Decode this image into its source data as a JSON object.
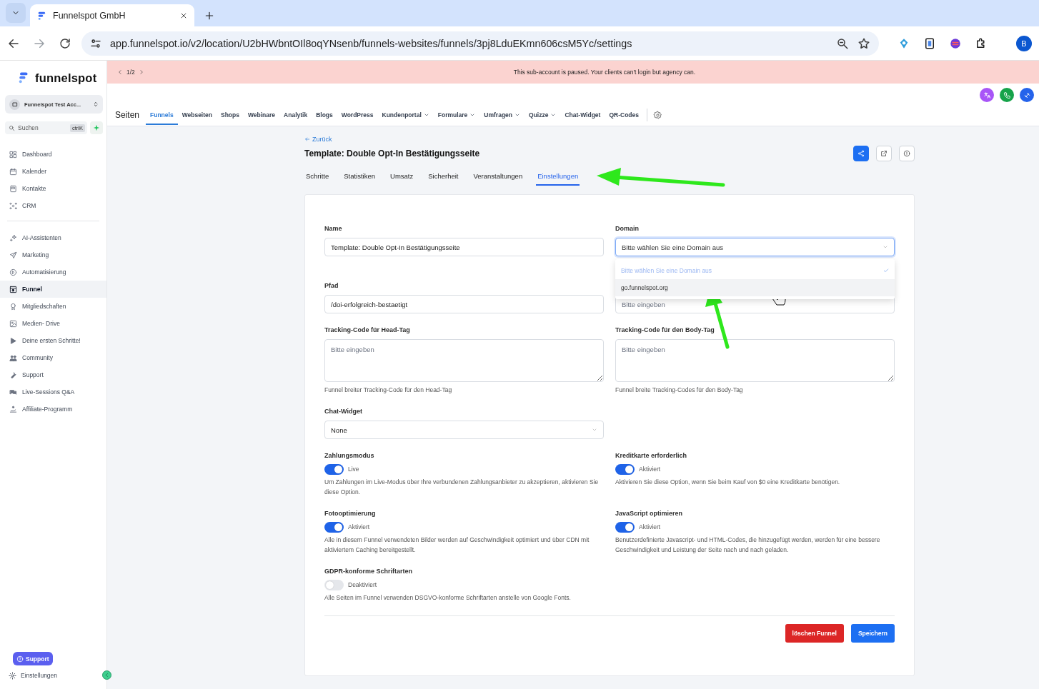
{
  "browser": {
    "tab_title": "Funnelspot GmbH",
    "url": "app.funnelspot.io/v2/location/U2bHWbntOIl8oqYNsenb/funnels-websites/funnels/3pj8LduEKmn606csM5Yc/settings",
    "profile_initial": "B"
  },
  "sidebar": {
    "logo": "funnelspot",
    "account": "Funnelspot Test Acc...",
    "search": {
      "placeholder": "Suchen",
      "shortcut": "ctrlK"
    },
    "groups": [
      {
        "items": [
          {
            "label": "Dashboard",
            "selected": false
          },
          {
            "label": "Kalender",
            "selected": false
          },
          {
            "label": "Kontakte",
            "selected": false
          },
          {
            "label": "CRM",
            "selected": false
          }
        ]
      },
      {
        "items": [
          {
            "label": "AI-Assistenten",
            "selected": false
          },
          {
            "label": "Marketing",
            "selected": false
          },
          {
            "label": "Automatisierung",
            "selected": false
          },
          {
            "label": "Funnel",
            "selected": true
          },
          {
            "label": "Mitgliedschaften",
            "selected": false
          },
          {
            "label": "Medien- Drive",
            "selected": false
          },
          {
            "label": "Deine ersten Schritte!",
            "selected": false
          },
          {
            "label": "Community",
            "selected": false
          },
          {
            "label": "Support",
            "selected": false
          },
          {
            "label": "Live-Sessions Q&A",
            "selected": false
          },
          {
            "label": "Affiliate-Programm",
            "selected": false
          }
        ]
      }
    ],
    "support_button": "Support",
    "settings": "Einstellungen"
  },
  "banner": {
    "pager": "1/2",
    "message": "This sub-account is paused. Your clients can't login but agency can."
  },
  "header": {
    "title": "Seiten",
    "nav": [
      {
        "label": "Funnels",
        "selected": true,
        "dropdown": false
      },
      {
        "label": "Webseiten",
        "selected": false,
        "dropdown": false
      },
      {
        "label": "Shops",
        "selected": false,
        "dropdown": false
      },
      {
        "label": "Webinare",
        "selected": false,
        "dropdown": false
      },
      {
        "label": "Analytik",
        "selected": false,
        "dropdown": false
      },
      {
        "label": "Blogs",
        "selected": false,
        "dropdown": false
      },
      {
        "label": "WordPress",
        "selected": false,
        "dropdown": false
      },
      {
        "label": "Kundenportal",
        "selected": false,
        "dropdown": true
      },
      {
        "label": "Formulare",
        "selected": false,
        "dropdown": true
      },
      {
        "label": "Umfragen",
        "selected": false,
        "dropdown": true
      },
      {
        "label": "Quizze",
        "selected": false,
        "dropdown": true
      },
      {
        "label": "Chat-Widget",
        "selected": false,
        "dropdown": false
      },
      {
        "label": "QR-Codes",
        "selected": false,
        "dropdown": false
      }
    ]
  },
  "page": {
    "back": "Zurück",
    "title": "Template: Double Opt-In Bestätigungsseite",
    "tabs": [
      {
        "label": "Schritte",
        "selected": false
      },
      {
        "label": "Statistiken",
        "selected": false
      },
      {
        "label": "Umsatz",
        "selected": false
      },
      {
        "label": "Sicherheit",
        "selected": false
      },
      {
        "label": "Veranstaltungen",
        "selected": false
      },
      {
        "label": "Einstellungen",
        "selected": true
      }
    ],
    "form": {
      "rows": [
        [
          {
            "kind": "text",
            "label": "Name",
            "value": "Template: Double Opt-In Bestätigungsseite"
          },
          {
            "kind": "select",
            "label": "Domain",
            "placeholder": "Bitte wählen Sie eine Domain aus",
            "expanded": true,
            "options": [
              {
                "label": "Bitte wählen Sie eine Domain aus",
                "selected": true,
                "hovered": false
              },
              {
                "label": "go.funnelspot.org",
                "selected": false,
                "hovered": true
              }
            ]
          }
        ],
        [
          {
            "kind": "text",
            "label": "Pfad",
            "value": "/doi-erfolgreich-bestaetigt"
          },
          {
            "kind": "text",
            "placeholder": "Bitte eingeben"
          }
        ],
        [
          {
            "kind": "textarea",
            "label": "Tracking-Code für Head-Tag",
            "placeholder": "Bitte eingeben",
            "help": "Funnel breiter Tracking-Code für den Head-Tag"
          },
          {
            "kind": "textarea",
            "label": "Tracking-Code für den Body-Tag",
            "placeholder": "Bitte eingeben",
            "help": "Funnel breite Tracking-Codes für den Body-Tag"
          }
        ],
        [
          {
            "kind": "select",
            "label": "Chat-Widget",
            "value": "None",
            "expanded": false
          }
        ],
        [
          {
            "kind": "toggle",
            "label": "Zahlungsmodus",
            "on": true,
            "state": "Live",
            "help": "Um Zahlungen im Live-Modus über Ihre verbundenen Zahlungsanbieter zu akzeptieren, aktivieren Sie diese Option."
          },
          {
            "kind": "toggle",
            "label": "Kreditkarte erforderlich",
            "on": true,
            "state": "Aktiviert",
            "help": "Aktivieren Sie diese Option, wenn Sie beim Kauf von $0 eine Kreditkarte benötigen."
          }
        ],
        [
          {
            "kind": "toggle",
            "label": "Fotooptimierung",
            "on": true,
            "state": "Aktiviert",
            "help": "Alle in diesem Funnel verwendeten Bilder werden auf Geschwindigkeit optimiert und über CDN mit aktiviertem Caching bereitgestellt."
          },
          {
            "kind": "toggle",
            "label": "JavaScript optimieren",
            "on": true,
            "state": "Aktiviert",
            "help": "Benutzerdefinierte Javascript- und HTML-Codes, die hinzugefügt werden, werden für eine bessere Geschwindigkeit und Leistung der Seite nach und nach geladen."
          }
        ],
        [
          {
            "kind": "toggle",
            "label": "GDPR-konforme Schriftarten",
            "on": false,
            "state": "Deaktiviert",
            "help": "Alle Seiten im Funnel verwenden DSGVO-konforme Schriftarten anstelle von Google Fonts."
          }
        ]
      ]
    },
    "buttons": [
      {
        "label": "löschen Funnel",
        "kind": "danger"
      },
      {
        "label": "Speichern",
        "kind": "primary"
      }
    ]
  }
}
